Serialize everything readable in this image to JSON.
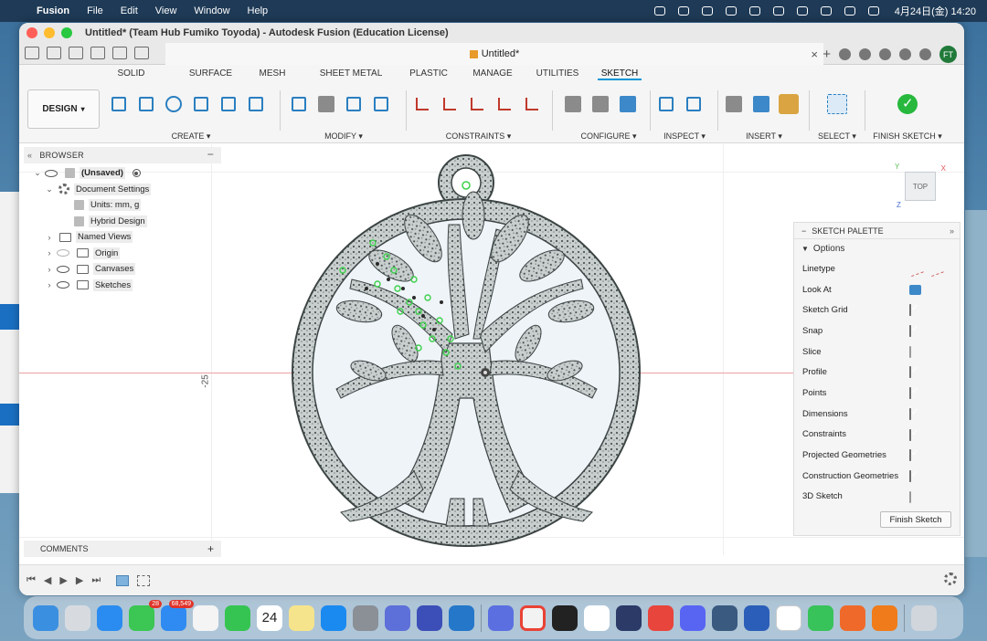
{
  "menubar": {
    "app": "Fusion",
    "items": [
      "File",
      "Edit",
      "View",
      "Window",
      "Help"
    ],
    "datetime": "4月24日(金)  14:20"
  },
  "window": {
    "title": "Untitled* (Team Hub Fumiko Toyoda) - Autodesk Fusion (Education License)",
    "doc_tab": "Untitled*",
    "user_initials": "FT"
  },
  "ribbon": {
    "workspace": "DESIGN",
    "tabs": [
      "SOLID",
      "SURFACE",
      "MESH",
      "SHEET METAL",
      "PLASTIC",
      "MANAGE",
      "UTILITIES",
      "SKETCH"
    ],
    "active_tab": "SKETCH",
    "groups": [
      "CREATE",
      "MODIFY",
      "CONSTRAINTS",
      "CONFIGURE",
      "INSPECT",
      "INSERT",
      "SELECT",
      "FINISH SKETCH"
    ]
  },
  "browser": {
    "title": "BROWSER",
    "nodes": [
      {
        "label": "(Unsaved)"
      },
      {
        "label": "Document Settings"
      },
      {
        "label": "Units: mm, g"
      },
      {
        "label": "Hybrid Design"
      },
      {
        "label": "Named Views"
      },
      {
        "label": "Origin"
      },
      {
        "label": "Canvases"
      },
      {
        "label": "Sketches"
      }
    ]
  },
  "viewport": {
    "ruler_label": "-25",
    "viewcube_face": "TOP",
    "axis_y": "Y",
    "axis_x": "X",
    "axis_z": "Z"
  },
  "palette": {
    "title": "SKETCH PALETTE",
    "section": "Options",
    "rows": [
      {
        "label": "Linetype",
        "kind": "linetype"
      },
      {
        "label": "Look At",
        "kind": "button"
      },
      {
        "label": "Sketch Grid",
        "kind": "check",
        "checked": true
      },
      {
        "label": "Snap",
        "kind": "check",
        "checked": true
      },
      {
        "label": "Slice",
        "kind": "check",
        "checked": false
      },
      {
        "label": "Profile",
        "kind": "check",
        "checked": true
      },
      {
        "label": "Points",
        "kind": "check",
        "checked": true
      },
      {
        "label": "Dimensions",
        "kind": "check",
        "checked": true
      },
      {
        "label": "Constraints",
        "kind": "check",
        "checked": true
      },
      {
        "label": "Projected Geometries",
        "kind": "check",
        "checked": true
      },
      {
        "label": "Construction Geometries",
        "kind": "check",
        "checked": true
      },
      {
        "label": "3D Sketch",
        "kind": "check",
        "checked": false
      }
    ],
    "finish_button": "Finish Sketch"
  },
  "comments": {
    "title": "COMMENTS"
  },
  "dock": {
    "messages_badge": "28",
    "mail_badge": "68,549",
    "calendar_day": "24"
  },
  "colors": {
    "accent": "#0696d7",
    "finish_green": "#27b83d",
    "sketch_green": "#3bd14a",
    "axis_red": "#e9a3a3"
  }
}
